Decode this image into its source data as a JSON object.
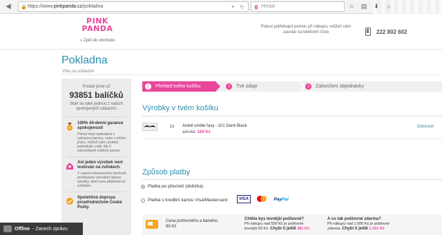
{
  "browser": {
    "url_prefix": "https://www.",
    "url_host": "pinkpanda.cz",
    "url_path": "/pokladna",
    "search_placeholder": "Hledat"
  },
  "header": {
    "logo_line1": "PINK",
    "logo_line2": "PANDA",
    "back_link": "« Zpět do obchodu",
    "help_text": "Pokud potřebuješ pomoc při nákupu, můžeš nám zavolat na telefonní číslo",
    "phone": "222 802 602"
  },
  "page": {
    "title": "Pokladna",
    "subtitle": "Vítej na pokladně"
  },
  "sidebar": {
    "sent_label": "Poslali jsme už",
    "parcels": "93851 balíčků",
    "be_one": "Staň se také jednou z našich spokojených zákazníc",
    "guarantee_title": "100% 44-denní garance spokojenosti",
    "guarantee_text": "Pokud nejsi spokojená s vybranou barvou, nebo s něčím jiným, můžeš nám výrobek jednoduše vrátit. My ti samozřejmě vrátíme peníze.",
    "animals_title": "Ani jeden výrobek není testován na zvířatech.",
    "animals_text": "V našem internetovém obchodě prodáváme výhradně takové výrobky, které jsou přátelské ke zvířatům.",
    "delivery_title": "Spolehlivá doprava prostřednictvím České Pošty."
  },
  "steps": [
    {
      "num": "1",
      "label": "Přehled tvého košíku"
    },
    {
      "num": "2",
      "label": "Tvé údaje"
    },
    {
      "num": "3",
      "label": "Zakončení objednávky"
    }
  ],
  "cart": {
    "title": "Výrobky v tvém košíku",
    "qty": "1x",
    "product_name": "Ardell umělé řasy - 101 Demi Black",
    "old_price": "197 Kč",
    "new_price": "169 Kč",
    "remove": "Odstranit"
  },
  "payment": {
    "title": "Způsob platby",
    "option1": "Platba po převzetí (dobírka)",
    "option2": "Platba s kreditní kartou Visa/Mastercard",
    "visa": "VISA",
    "paypal_a": "Pay",
    "paypal_b": "Pal"
  },
  "bottom": {
    "post_line1": "Cena poštovného a balného",
    "post_line2": "99 Kč",
    "cheaper_title": "Chtěla bys levnější poštovné?",
    "cheaper_line1": "Při nákupu nad 550 Kč je poštovné",
    "cheaper_line2a": "levnější 59 Kč. ",
    "cheaper_line2b": "Chybí ti ještě",
    "cheaper_line2c": " 381 Kč",
    "free_title": "A co tak poštovné zdarma?",
    "free_line1": "Při nákupu nad 1.500 Kč je poštovné",
    "free_line2a": "zdarma. ",
    "free_line2b": "Chybí ti ještě",
    "free_line2c": " 1.331 Kč"
  },
  "chat": {
    "status": "Offline",
    "action": "- Zanech zprávu"
  },
  "colors": {
    "pink": "#e8479b",
    "blue": "#2a8fb0"
  }
}
